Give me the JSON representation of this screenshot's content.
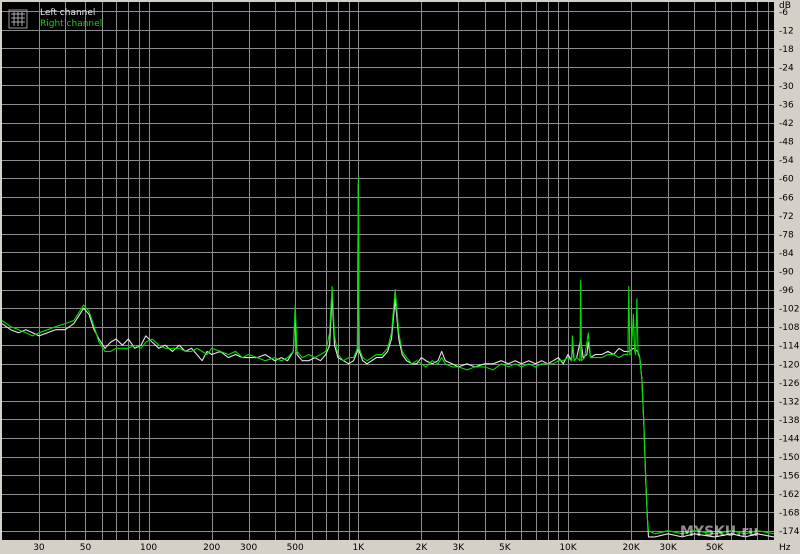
{
  "colors": {
    "background": "#000000",
    "grid": "#8c8c8c",
    "left": "#e6e6e6",
    "right": "#00dd00",
    "frame": "#d4d0c8"
  },
  "watermark": "MYSKU.ru",
  "chart_data": {
    "type": "line",
    "title": "",
    "xlabel": "",
    "ylabel": "",
    "x_unit": "Hz",
    "y_unit": "dB",
    "x_scale": "log",
    "xlim": [
      20,
      96000
    ],
    "ylim": [
      -177,
      -3
    ],
    "grid": true,
    "legend_position": "top-left",
    "x_ticks": [
      {
        "v": 30,
        "label": "30"
      },
      {
        "v": 50,
        "label": "50"
      },
      {
        "v": 100,
        "label": "100"
      },
      {
        "v": 200,
        "label": "200"
      },
      {
        "v": 300,
        "label": "300"
      },
      {
        "v": 500,
        "label": "500"
      },
      {
        "v": 1000,
        "label": "1K"
      },
      {
        "v": 2000,
        "label": "2K"
      },
      {
        "v": 3000,
        "label": "3K"
      },
      {
        "v": 5000,
        "label": "5K"
      },
      {
        "v": 10000,
        "label": "10K"
      },
      {
        "v": 20000,
        "label": "20K"
      },
      {
        "v": 30000,
        "label": "30K"
      },
      {
        "v": 50000,
        "label": "50K"
      }
    ],
    "x_end_label": "Hz",
    "y_ticks": [
      "dB",
      "-6",
      "-12",
      "-18",
      "-24",
      "-30",
      "-36",
      "-42",
      "-48",
      "-54",
      "-60",
      "-66",
      "-72",
      "-78",
      "-84",
      "-90",
      "-96",
      "-102",
      "-108",
      "-114",
      "-120",
      "-126",
      "-132",
      "-138",
      "-144",
      "-150",
      "-156",
      "-162",
      "-168",
      "-174"
    ],
    "series": [
      {
        "name": "Left channel",
        "color": "#e6e6e6",
        "points": [
          [
            20,
            -107
          ],
          [
            22,
            -109
          ],
          [
            24,
            -110
          ],
          [
            26,
            -109
          ],
          [
            28,
            -110
          ],
          [
            30,
            -111
          ],
          [
            33,
            -110
          ],
          [
            36,
            -109
          ],
          [
            40,
            -109
          ],
          [
            44,
            -107
          ],
          [
            47,
            -104
          ],
          [
            49,
            -102
          ],
          [
            52,
            -104
          ],
          [
            55,
            -109
          ],
          [
            58,
            -112
          ],
          [
            62,
            -115
          ],
          [
            66,
            -113
          ],
          [
            70,
            -112
          ],
          [
            75,
            -114
          ],
          [
            80,
            -112
          ],
          [
            86,
            -115
          ],
          [
            92,
            -114
          ],
          [
            97,
            -111
          ],
          [
            104,
            -113
          ],
          [
            112,
            -115
          ],
          [
            120,
            -114
          ],
          [
            130,
            -116
          ],
          [
            140,
            -114
          ],
          [
            150,
            -116
          ],
          [
            160,
            -115
          ],
          [
            170,
            -117
          ],
          [
            180,
            -119
          ],
          [
            190,
            -116
          ],
          [
            200,
            -117
          ],
          [
            220,
            -116
          ],
          [
            240,
            -118
          ],
          [
            260,
            -117
          ],
          [
            280,
            -118
          ],
          [
            300,
            -118
          ],
          [
            330,
            -118
          ],
          [
            360,
            -117
          ],
          [
            400,
            -119
          ],
          [
            430,
            -118
          ],
          [
            460,
            -119
          ],
          [
            490,
            -116
          ],
          [
            500,
            -104
          ],
          [
            510,
            -117
          ],
          [
            540,
            -119
          ],
          [
            580,
            -119
          ],
          [
            620,
            -118
          ],
          [
            660,
            -119
          ],
          [
            700,
            -117
          ],
          [
            730,
            -114
          ],
          [
            750,
            -98
          ],
          [
            770,
            -114
          ],
          [
            800,
            -118
          ],
          [
            850,
            -119
          ],
          [
            900,
            -120
          ],
          [
            950,
            -119
          ],
          [
            990,
            -116
          ],
          [
            1000,
            -62
          ],
          [
            1010,
            -116
          ],
          [
            1050,
            -119
          ],
          [
            1100,
            -120
          ],
          [
            1160,
            -119
          ],
          [
            1220,
            -118
          ],
          [
            1300,
            -118
          ],
          [
            1380,
            -116
          ],
          [
            1440,
            -112
          ],
          [
            1500,
            -99
          ],
          [
            1560,
            -112
          ],
          [
            1620,
            -117
          ],
          [
            1700,
            -119
          ],
          [
            1800,
            -120
          ],
          [
            1900,
            -120
          ],
          [
            2000,
            -118
          ],
          [
            2100,
            -119
          ],
          [
            2250,
            -120
          ],
          [
            2400,
            -119
          ],
          [
            2500,
            -116
          ],
          [
            2600,
            -119
          ],
          [
            2800,
            -120
          ],
          [
            3000,
            -121
          ],
          [
            3300,
            -120
          ],
          [
            3600,
            -121
          ],
          [
            4000,
            -120
          ],
          [
            4400,
            -120
          ],
          [
            4800,
            -119
          ],
          [
            5200,
            -120
          ],
          [
            5600,
            -119
          ],
          [
            6000,
            -120
          ],
          [
            6500,
            -119
          ],
          [
            7000,
            -120
          ],
          [
            7500,
            -119
          ],
          [
            8000,
            -120
          ],
          [
            8500,
            -119
          ],
          [
            9000,
            -118
          ],
          [
            9500,
            -120
          ],
          [
            10000,
            -117
          ],
          [
            10400,
            -119
          ],
          [
            10500,
            -114
          ],
          [
            10700,
            -119
          ],
          [
            11000,
            -118
          ],
          [
            11500,
            -112
          ],
          [
            11800,
            -118
          ],
          [
            12300,
            -117
          ],
          [
            12500,
            -113
          ],
          [
            12800,
            -118
          ],
          [
            13500,
            -117
          ],
          [
            14500,
            -117
          ],
          [
            15500,
            -116
          ],
          [
            16500,
            -117
          ],
          [
            17500,
            -115
          ],
          [
            18500,
            -116
          ],
          [
            19500,
            -116
          ],
          [
            20500,
            -115
          ],
          [
            21500,
            -116
          ],
          [
            22000,
            -118
          ],
          [
            22500,
            -125
          ],
          [
            23000,
            -140
          ],
          [
            23500,
            -158
          ],
          [
            23900,
            -170
          ],
          [
            24200,
            -176
          ],
          [
            26000,
            -176
          ],
          [
            30000,
            -175
          ],
          [
            35000,
            -176
          ],
          [
            40000,
            -175
          ],
          [
            50000,
            -176
          ],
          [
            60000,
            -175
          ],
          [
            70000,
            -176
          ],
          [
            80000,
            -175
          ],
          [
            96000,
            -176
          ]
        ]
      },
      {
        "name": "Right channel",
        "color": "#00dd00",
        "points": [
          [
            20,
            -106
          ],
          [
            22,
            -108
          ],
          [
            24,
            -109
          ],
          [
            26,
            -110
          ],
          [
            28,
            -111
          ],
          [
            30,
            -110
          ],
          [
            33,
            -109
          ],
          [
            36,
            -108
          ],
          [
            40,
            -107
          ],
          [
            44,
            -106
          ],
          [
            47,
            -103
          ],
          [
            49,
            -101
          ],
          [
            52,
            -103
          ],
          [
            55,
            -108
          ],
          [
            58,
            -113
          ],
          [
            62,
            -116
          ],
          [
            66,
            -116
          ],
          [
            70,
            -115
          ],
          [
            75,
            -115
          ],
          [
            80,
            -115
          ],
          [
            86,
            -114
          ],
          [
            92,
            -115
          ],
          [
            97,
            -113
          ],
          [
            104,
            -112
          ],
          [
            112,
            -114
          ],
          [
            120,
            -115
          ],
          [
            130,
            -115
          ],
          [
            140,
            -115
          ],
          [
            150,
            -116
          ],
          [
            160,
            -116
          ],
          [
            170,
            -115
          ],
          [
            180,
            -116
          ],
          [
            190,
            -117
          ],
          [
            200,
            -115
          ],
          [
            220,
            -116
          ],
          [
            240,
            -117
          ],
          [
            260,
            -116
          ],
          [
            280,
            -118
          ],
          [
            300,
            -117
          ],
          [
            330,
            -118
          ],
          [
            360,
            -119
          ],
          [
            400,
            -118
          ],
          [
            430,
            -119
          ],
          [
            460,
            -118
          ],
          [
            490,
            -116
          ],
          [
            500,
            -101
          ],
          [
            510,
            -116
          ],
          [
            540,
            -118
          ],
          [
            580,
            -117
          ],
          [
            620,
            -118
          ],
          [
            660,
            -117
          ],
          [
            700,
            -116
          ],
          [
            730,
            -110
          ],
          [
            750,
            -95
          ],
          [
            770,
            -111
          ],
          [
            800,
            -117
          ],
          [
            850,
            -119
          ],
          [
            900,
            -118
          ],
          [
            950,
            -118
          ],
          [
            990,
            -115
          ],
          [
            1000,
            -60
          ],
          [
            1010,
            -115
          ],
          [
            1050,
            -118
          ],
          [
            1100,
            -119
          ],
          [
            1160,
            -118
          ],
          [
            1220,
            -117
          ],
          [
            1300,
            -117
          ],
          [
            1380,
            -115
          ],
          [
            1440,
            -110
          ],
          [
            1500,
            -96
          ],
          [
            1560,
            -110
          ],
          [
            1620,
            -116
          ],
          [
            1700,
            -118
          ],
          [
            1800,
            -120
          ],
          [
            1900,
            -119
          ],
          [
            2000,
            -120
          ],
          [
            2100,
            -121
          ],
          [
            2250,
            -119
          ],
          [
            2400,
            -120
          ],
          [
            2500,
            -118
          ],
          [
            2600,
            -120
          ],
          [
            2800,
            -121
          ],
          [
            3000,
            -121
          ],
          [
            3300,
            -122
          ],
          [
            3600,
            -121
          ],
          [
            4000,
            -121
          ],
          [
            4400,
            -122
          ],
          [
            4800,
            -120
          ],
          [
            5200,
            -121
          ],
          [
            5600,
            -120
          ],
          [
            6000,
            -121
          ],
          [
            6500,
            -120
          ],
          [
            7000,
            -121
          ],
          [
            7500,
            -120
          ],
          [
            8000,
            -120
          ],
          [
            8500,
            -120
          ],
          [
            9000,
            -119
          ],
          [
            9500,
            -119
          ],
          [
            10000,
            -118
          ],
          [
            10400,
            -119
          ],
          [
            10500,
            -111
          ],
          [
            10700,
            -119
          ],
          [
            11000,
            -118
          ],
          [
            11400,
            -119
          ],
          [
            11500,
            -93
          ],
          [
            11600,
            -119
          ],
          [
            12000,
            -118
          ],
          [
            12500,
            -110
          ],
          [
            12800,
            -118
          ],
          [
            13500,
            -118
          ],
          [
            14500,
            -118
          ],
          [
            15500,
            -117
          ],
          [
            16500,
            -117
          ],
          [
            17500,
            -118
          ],
          [
            18500,
            -117
          ],
          [
            19300,
            -117
          ],
          [
            19500,
            -95
          ],
          [
            19700,
            -117
          ],
          [
            20000,
            -117
          ],
          [
            20500,
            -104
          ],
          [
            20800,
            -116
          ],
          [
            21000,
            -117
          ],
          [
            21300,
            -99
          ],
          [
            21600,
            -117
          ],
          [
            22000,
            -118
          ],
          [
            22500,
            -125
          ],
          [
            23000,
            -140
          ],
          [
            23500,
            -158
          ],
          [
            23900,
            -170
          ],
          [
            24200,
            -174
          ],
          [
            26000,
            -175
          ],
          [
            30000,
            -174
          ],
          [
            35000,
            -175
          ],
          [
            40000,
            -174
          ],
          [
            50000,
            -175
          ],
          [
            60000,
            -174
          ],
          [
            70000,
            -175
          ],
          [
            80000,
            -174
          ],
          [
            96000,
            -175
          ]
        ]
      }
    ]
  }
}
